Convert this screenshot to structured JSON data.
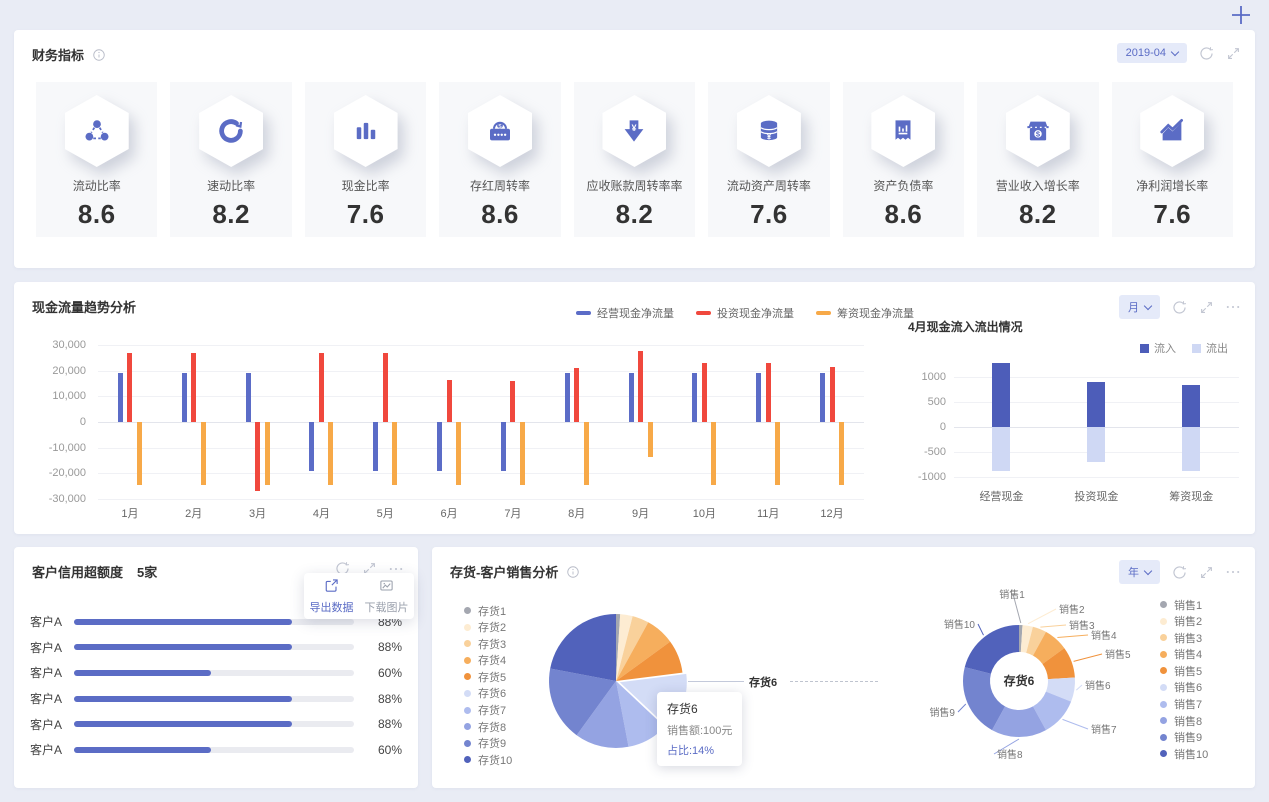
{
  "financial_panel": {
    "title": "财务指标",
    "period": "2019-04",
    "metrics": [
      {
        "label": "流动比率",
        "value": "8.6",
        "icon": "share-network-icon"
      },
      {
        "label": "速动比率",
        "value": "8.2",
        "icon": "sync-ring-icon"
      },
      {
        "label": "现金比率",
        "value": "7.6",
        "icon": "bar-chart-icon"
      },
      {
        "label": "存红周转率",
        "value": "8.6",
        "icon": "wallet-icon"
      },
      {
        "label": "应收账款周转率率",
        "value": "8.2",
        "icon": "arrow-down-yuan-icon"
      },
      {
        "label": "流动资产周转率",
        "value": "7.6",
        "icon": "coins-yuan-icon"
      },
      {
        "label": "资产负债率",
        "value": "8.6",
        "icon": "receipt-icon"
      },
      {
        "label": "营业收入增长率",
        "value": "8.2",
        "icon": "storefront-icon"
      },
      {
        "label": "净利润增长率",
        "value": "7.6",
        "icon": "trend-line-icon"
      }
    ]
  },
  "cashflow_panel": {
    "title": "现金流量趋势分析",
    "period_selector": "月",
    "sub_title": "4月现金流入流出情况"
  },
  "credit_panel": {
    "title": "客户信用超额度",
    "count": "5家",
    "menu": [
      {
        "label": "导出数据",
        "icon": "export-icon"
      },
      {
        "label": "下载图片",
        "icon": "download-image-icon"
      }
    ]
  },
  "inventory_panel": {
    "title": "存货-客户销售分析",
    "period_selector": "年",
    "pie_callout": "存货6",
    "donut_center": "存货6",
    "tooltip": {
      "title": "存货6",
      "sales": "销售额:100元",
      "share": "占比:14%"
    }
  },
  "chart_data": [
    {
      "id": "cashflow-trend",
      "type": "bar",
      "title": "现金流量趋势分析",
      "categories": [
        "1月",
        "2月",
        "3月",
        "4月",
        "5月",
        "6月",
        "7月",
        "8月",
        "9月",
        "10月",
        "11月",
        "12月"
      ],
      "series": [
        {
          "name": "经营现金净流量",
          "color": "#5b6cc7",
          "values": [
            19000,
            19000,
            19000,
            -19000,
            -19000,
            -19000,
            -19000,
            19000,
            19000,
            19000,
            19000,
            19000
          ]
        },
        {
          "name": "投资现金净流量",
          "color": "#f0483d",
          "values": [
            27000,
            27000,
            -27000,
            27000,
            27000,
            16500,
            16000,
            21000,
            27500,
            23000,
            23000,
            21500
          ]
        },
        {
          "name": "筹资现金净流量",
          "color": "#f7a948",
          "values": [
            -24500,
            -24500,
            -24500,
            -24500,
            -24500,
            -24500,
            -24500,
            -24500,
            -13500,
            -24500,
            -24500,
            -24500
          ]
        }
      ],
      "ylim": [
        -30000,
        30000
      ],
      "grid": true,
      "legend_position": "top",
      "yticks": [
        {
          "v": 30000,
          "label": "30,000"
        },
        {
          "v": 20000,
          "label": "20,000"
        },
        {
          "v": 10000,
          "label": "10,000"
        },
        {
          "v": 0,
          "label": "0"
        },
        {
          "v": -10000,
          "label": "-10,000"
        },
        {
          "v": -20000,
          "label": "-20,000"
        },
        {
          "v": -30000,
          "label": "-30,000"
        }
      ]
    },
    {
      "id": "april-cash-in-out",
      "type": "bar",
      "stacked": true,
      "title": "4月现金流入流出情况",
      "categories": [
        "经营现金",
        "投资现金",
        "筹资现金"
      ],
      "series": [
        {
          "name": "流入",
          "color": "#4d5db9",
          "values": [
            1280,
            900,
            850
          ]
        },
        {
          "name": "流出",
          "color": "#cfd8f4",
          "values": [
            -870,
            -700,
            -870
          ]
        }
      ],
      "ylim": [
        -1000,
        1350
      ],
      "legend_position": "top-right",
      "yticks": [
        {
          "v": 1000,
          "label": "1000"
        },
        {
          "v": 500,
          "label": "500"
        },
        {
          "v": 0,
          "label": "0"
        },
        {
          "v": -500,
          "label": "-500"
        },
        {
          "v": -1000,
          "label": "-1000"
        }
      ]
    },
    {
      "id": "customer-credit",
      "type": "bar",
      "orientation": "horizontal",
      "title": "客户信用超额度",
      "rows": [
        {
          "label": "客户A",
          "value": "88%",
          "fill_pct": 78
        },
        {
          "label": "客户A",
          "value": "88%",
          "fill_pct": 78
        },
        {
          "label": "客户A",
          "value": "60%",
          "fill_pct": 49
        },
        {
          "label": "客户A",
          "value": "88%",
          "fill_pct": 78
        },
        {
          "label": "客户A",
          "value": "88%",
          "fill_pct": 78
        },
        {
          "label": "客户A",
          "value": "60%",
          "fill_pct": 49
        }
      ]
    },
    {
      "id": "inventory-pie",
      "type": "pie",
      "title": "存货占比",
      "labels": [
        "存货1",
        "存货2",
        "存货3",
        "存货4",
        "存货5",
        "存货6",
        "存货7",
        "存货8",
        "存货9",
        "存货10"
      ],
      "values": [
        1,
        3,
        4,
        7,
        8,
        14,
        10,
        13,
        18,
        22
      ],
      "colors": [
        "#a4a7b0",
        "#fdecd2",
        "#f9d19b",
        "#f6ae5d",
        "#f0923c",
        "#d3dcf6",
        "#aebcee",
        "#94a3e2",
        "#7384cf",
        "#5162bb"
      ],
      "highlight_label": "存货6",
      "highlight_value_pct": 14,
      "highlight_sales": "100元"
    },
    {
      "id": "sales-donut",
      "type": "pie",
      "donut": true,
      "title": "销售占比",
      "labels": [
        "销售1",
        "销售2",
        "销售3",
        "销售4",
        "销售5",
        "销售6",
        "销售7",
        "销售8",
        "销售9",
        "销售10"
      ],
      "values": [
        1,
        3,
        4,
        7,
        9,
        7,
        11,
        16,
        21,
        21
      ],
      "colors": [
        "#a4a7b0",
        "#fdecd2",
        "#f9d19b",
        "#f6ae5d",
        "#f0923c",
        "#d3dcf6",
        "#aebcee",
        "#94a3e2",
        "#7384cf",
        "#5162bb"
      ],
      "center_label": "存货6"
    }
  ]
}
